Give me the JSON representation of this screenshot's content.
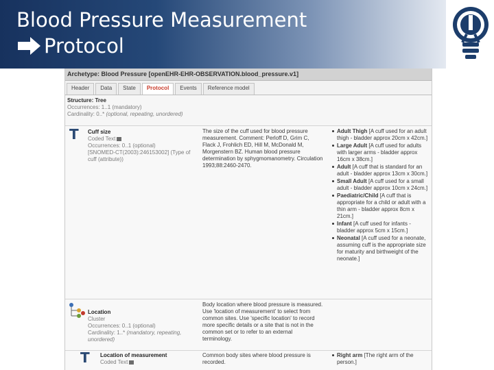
{
  "slide": {
    "title_line1": "Blood Pressure Measurement",
    "title_line2": "Protocol"
  },
  "archetype": {
    "label": "Archetype: Blood Pressure [openEHR-EHR-OBSERVATION.blood_pressure.v1]",
    "tabs": [
      {
        "label": "Header",
        "active": false
      },
      {
        "label": "Data",
        "active": false
      },
      {
        "label": "State",
        "active": false
      },
      {
        "label": "Protocol",
        "active": true
      },
      {
        "label": "Events",
        "active": false
      },
      {
        "label": "Reference model",
        "active": false
      }
    ],
    "structure": {
      "line1": "Structure: Tree",
      "line2": "Occurrences: 1..1 (mandatory)",
      "line3_label": "Cardinality: 0..*",
      "line3_qual": "(optional, repeating, unordered)"
    },
    "items": [
      {
        "icon": "text-type-icon",
        "name": "Cuff size",
        "type": "Coded Text",
        "occurrences": "Occurrences: 0..1 (optional)",
        "binding": "[SNOMED-CT(2003):246153002] (Type of cuff (attribute))",
        "description": "The size of the cuff used for blood pressure measurement. Comment: Perloff D, Grim C, Flack J, Frohlich ED, Hill M, McDonald M, Morgenstern BZ. Human blood pressure determination by sphygmomanometry. Circulation 1993;88:2460-2470.",
        "values": [
          {
            "term": "Adult Thigh",
            "detail": "[A cuff used for an adult thigh - bladder approx 20cm x 42cm.]"
          },
          {
            "term": "Large Adult",
            "detail": "[A cuff used for adults with larger arms - bladder approx 16cm x 38cm.]"
          },
          {
            "term": "Adult",
            "detail": "[A cuff that is standard for an adult - bladder approx 13cm x 30cm.]"
          },
          {
            "term": "Small Adult",
            "detail": "[A cuff used for a small adult - bladder approx 10cm x 24cm.]"
          },
          {
            "term": "Paediatric/Child",
            "detail": "[A cuff that is appropriate for a child or adult with a thin arm - bladder approx 8cm x 21cm.]"
          },
          {
            "term": "Infant",
            "detail": "[A cuff used for infants - bladder approx 5cm x 15cm.]"
          },
          {
            "term": "Neonatal",
            "detail": "[A cuff used for a neonate, assuming cuff is the appropriate size for maturity and birthweight of the neonate.]"
          }
        ]
      },
      {
        "icon": "cluster-icon",
        "name": "Location",
        "type": "Cluster",
        "occurrences": "Occurrences: 0..1 (optional)",
        "cardinality_label": "Cardinality: 1..*",
        "cardinality_qual": "(mandatory, repeating, unordered)",
        "description": "Body location where blood pressure is measured. Use 'location of measurement' to select from common sites. Use 'specific location' to record more specific details or a site that is not in the common set or to refer to an external terminology."
      },
      {
        "icon": "text-type-icon",
        "name": "Location of measurement",
        "type": "Coded Text",
        "description": "Common body sites where blood pressure is recorded.",
        "values": [
          {
            "term": "Right arm",
            "detail": "[The right arm of the person.]"
          }
        ]
      }
    ]
  }
}
